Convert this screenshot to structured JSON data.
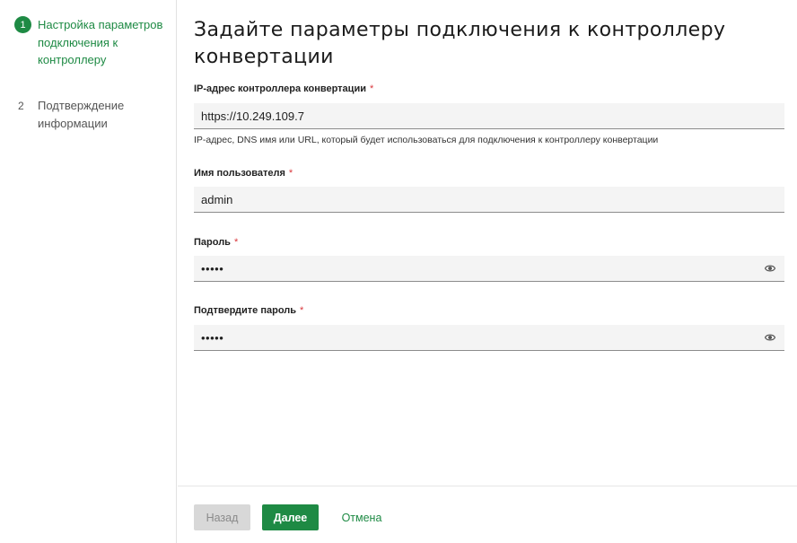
{
  "sidebar": {
    "steps": [
      {
        "number": "1",
        "label": "Настройка параметров подключения к контроллеру",
        "state": "active"
      },
      {
        "number": "2",
        "label": "Подтверждение информации",
        "state": "inactive"
      }
    ]
  },
  "main": {
    "title": "Задайте параметры подключения к контроллеру конвертации",
    "fields": {
      "ip": {
        "label": "IP-адрес контроллера конвертации",
        "required_mark": "*",
        "value": "https://10.249.109.7",
        "helper": "IP-адрес, DNS имя или URL, который будет использоваться для подключения к контроллеру конвертации"
      },
      "username": {
        "label": "Имя пользователя",
        "required_mark": "*",
        "value": "admin"
      },
      "password": {
        "label": "Пароль",
        "required_mark": "*",
        "value": "•••••",
        "icon": "eye-icon"
      },
      "confirm_password": {
        "label": "Подтвердите пароль",
        "required_mark": "*",
        "value": "•••••",
        "icon": "eye-icon"
      }
    }
  },
  "footer": {
    "back_label": "Назад",
    "next_label": "Далее",
    "cancel_label": "Отмена"
  },
  "colors": {
    "accent": "#1e8a44",
    "required": "#d9373c",
    "disabled_bg": "#d8d8d8",
    "input_bg": "#f4f4f4"
  }
}
